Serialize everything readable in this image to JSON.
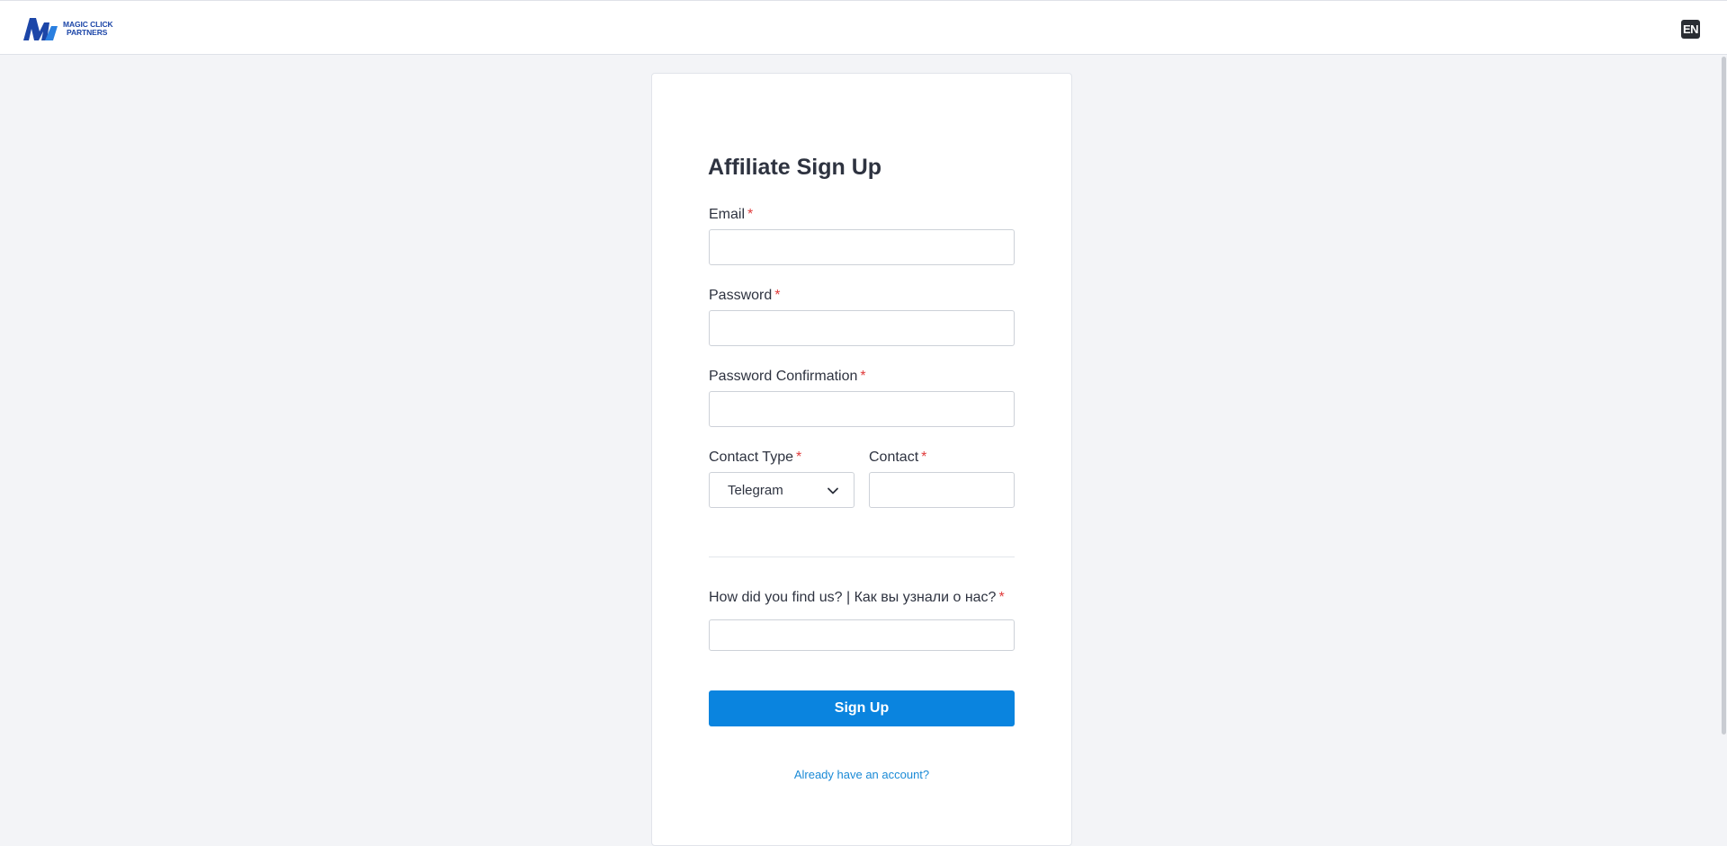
{
  "header": {
    "logo_line1": "MAGIC CLICK",
    "logo_line2": "PARTNERS",
    "language": "EN"
  },
  "form": {
    "title": "Affiliate Sign Up",
    "required_mark": "*",
    "email_label": "Email",
    "email_value": "",
    "password_label": "Password",
    "password_value": "",
    "password_confirmation_label": "Password Confirmation",
    "password_confirmation_value": "",
    "contact_type_label": "Contact Type",
    "contact_type_selected": "Telegram",
    "contact_label": "Contact",
    "contact_value": "",
    "source_label": "How did you find us? | Как вы узнали о нас?",
    "source_value": "",
    "submit_label": "Sign Up",
    "login_link": "Already have an account?"
  },
  "colors": {
    "brand_blue": "#1c46a8",
    "primary_button": "#0a84df",
    "link": "#1a8ad6",
    "required": "#e03b3b",
    "background": "#f3f4f7"
  },
  "icons": [
    "logo-icon",
    "chevron-down-icon"
  ]
}
